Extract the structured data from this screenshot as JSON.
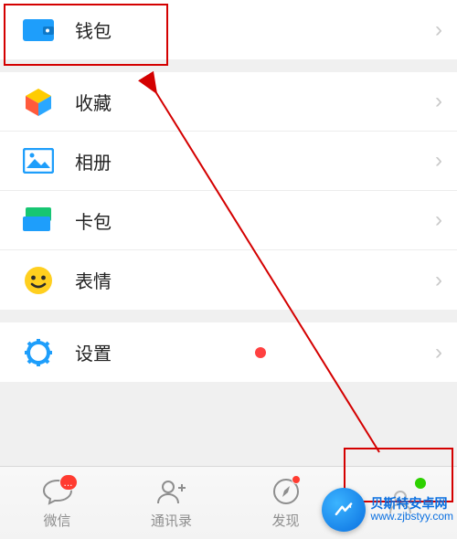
{
  "sections": {
    "wallet": {
      "label": "钱包"
    },
    "favorites": {
      "label": "收藏"
    },
    "album": {
      "label": "相册"
    },
    "cards": {
      "label": "卡包"
    },
    "stickers": {
      "label": "表情"
    },
    "settings": {
      "label": "设置",
      "has_badge": true
    }
  },
  "tabs": {
    "chats": {
      "label": "微信",
      "badge": "..."
    },
    "contacts": {
      "label": "通讯录"
    },
    "discover": {
      "label": "发现",
      "has_dot": true
    },
    "me": {
      "label": ""
    }
  },
  "watermark": {
    "line1": "贝斯特安卓网",
    "line2": "www.zjbstyy.com"
  }
}
